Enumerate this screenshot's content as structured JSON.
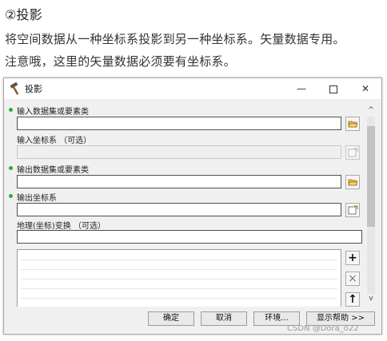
{
  "caption": {
    "heading": "②投影",
    "line1": "将空间数据从一种坐标系投影到另一种坐标系。矢量数据专用。",
    "line2": "注意哦，这里的矢量数据必须要有坐标系。"
  },
  "dialog": {
    "title": "投影",
    "title_icon": "hammer-icon",
    "window_buttons": {
      "minimize": "—",
      "maximize": "maximize-icon",
      "close": "✕"
    },
    "params": [
      {
        "label": "输入数据集或要素类",
        "required": true,
        "value": "",
        "button_icon": "folder-open-icon"
      },
      {
        "label": "输入坐标系 （可选）",
        "required": false,
        "value": "",
        "button_icon": "properties-icon",
        "disabled": true
      },
      {
        "label": "输出数据集或要素类",
        "required": true,
        "value": "",
        "button_icon": "folder-open-icon"
      },
      {
        "label": "输出坐标系",
        "required": true,
        "value": "",
        "button_icon": "properties-icon"
      },
      {
        "label": "地理(坐标)变换 （可选）",
        "required": false,
        "value": ""
      }
    ],
    "list_buttons": {
      "add": "+",
      "remove": "×",
      "up": "↑"
    },
    "scroll": {
      "up": "^",
      "down": "v"
    },
    "footer": {
      "ok": "确定",
      "cancel": "取消",
      "env": "环境...",
      "help": "显示帮助 >>"
    }
  },
  "watermark": "CSDN @Dora_o22",
  "colors": {
    "required_dot": "#2fae2f",
    "dialog_bg": "#f0f0f0"
  }
}
